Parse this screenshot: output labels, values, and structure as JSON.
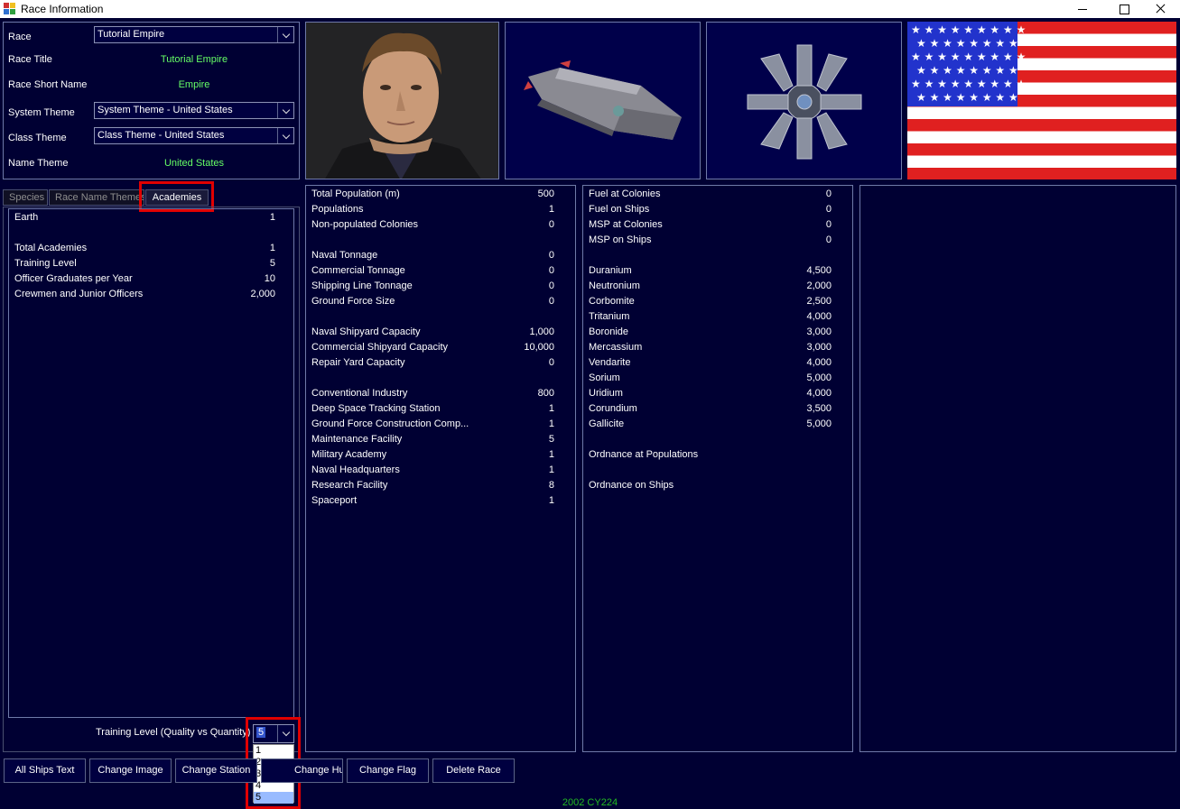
{
  "window": {
    "title": "Race Information"
  },
  "race_info": {
    "race_label": "Race",
    "race_value": "Tutorial Empire",
    "race_title_label": "Race Title",
    "race_title_value": "Tutorial Empire",
    "short_name_label": "Race Short Name",
    "short_name_value": "Empire",
    "system_theme_label": "System Theme",
    "system_theme_value": "System Theme - United States",
    "class_theme_label": "Class Theme",
    "class_theme_value": "Class Theme - United States",
    "name_theme_label": "Name Theme",
    "name_theme_value": "United States"
  },
  "tabs": [
    "Species",
    "Race Name Themes",
    "Academies"
  ],
  "academies": {
    "rows": [
      {
        "k": "Earth",
        "v": "1"
      },
      {
        "k": "",
        "v": ""
      },
      {
        "k": "Total Academies",
        "v": "1"
      },
      {
        "k": "Training Level",
        "v": "5"
      },
      {
        "k": "Officer Graduates per Year",
        "v": "10"
      },
      {
        "k": "Crewmen and Junior Officers",
        "v": "2,000"
      }
    ],
    "training_label": "Training Level (Quality vs Quantity)",
    "training_value": "5",
    "options": [
      "1",
      "2",
      "3",
      "4",
      "5"
    ],
    "selected_option": "5"
  },
  "stats": [
    {
      "k": "Total Population (m)",
      "v": "500"
    },
    {
      "k": "Populations",
      "v": "1"
    },
    {
      "k": "Non-populated Colonies",
      "v": "0"
    },
    {
      "k": "",
      "v": ""
    },
    {
      "k": "Naval Tonnage",
      "v": "0"
    },
    {
      "k": "Commercial Tonnage",
      "v": "0"
    },
    {
      "k": "Shipping Line Tonnage",
      "v": "0"
    },
    {
      "k": "Ground Force Size",
      "v": "0"
    },
    {
      "k": "",
      "v": ""
    },
    {
      "k": "Naval Shipyard Capacity",
      "v": "1,000"
    },
    {
      "k": "Commercial Shipyard Capacity",
      "v": "10,000"
    },
    {
      "k": "Repair Yard Capacity",
      "v": "0"
    },
    {
      "k": "",
      "v": ""
    },
    {
      "k": "Conventional Industry",
      "v": "800"
    },
    {
      "k": "Deep Space Tracking Station",
      "v": "1"
    },
    {
      "k": "Ground Force Construction Comp...",
      "v": "1"
    },
    {
      "k": "Maintenance Facility",
      "v": "5"
    },
    {
      "k": "Military Academy",
      "v": "1"
    },
    {
      "k": "Naval Headquarters",
      "v": "1"
    },
    {
      "k": "Research Facility",
      "v": "8"
    },
    {
      "k": "Spaceport",
      "v": "1"
    }
  ],
  "resources": [
    {
      "k": "Fuel at Colonies",
      "v": "0"
    },
    {
      "k": "Fuel on Ships",
      "v": "0"
    },
    {
      "k": "MSP at Colonies",
      "v": "0"
    },
    {
      "k": "MSP on Ships",
      "v": "0"
    },
    {
      "k": "",
      "v": ""
    },
    {
      "k": "Duranium",
      "v": "4,500"
    },
    {
      "k": "Neutronium",
      "v": "2,000"
    },
    {
      "k": "Corbomite",
      "v": "2,500"
    },
    {
      "k": "Tritanium",
      "v": "4,000"
    },
    {
      "k": "Boronide",
      "v": "3,000"
    },
    {
      "k": "Mercassium",
      "v": "3,000"
    },
    {
      "k": "Vendarite",
      "v": "4,000"
    },
    {
      "k": "Sorium",
      "v": "5,000"
    },
    {
      "k": "Uridium",
      "v": "4,000"
    },
    {
      "k": "Corundium",
      "v": "3,500"
    },
    {
      "k": "Gallicite",
      "v": "5,000"
    },
    {
      "k": "",
      "v": ""
    },
    {
      "k": "Ordnance at Populations",
      "v": ""
    },
    {
      "k": "",
      "v": ""
    },
    {
      "k": "Ordnance on Ships",
      "v": ""
    }
  ],
  "buttons": {
    "all_ships_text": "All Ships Text",
    "change_image": "Change Image",
    "change_station": "Change Station",
    "change_hull": "Change Hull",
    "change_flag": "Change Flag",
    "delete_race": "Delete Race"
  },
  "status": "2002 CY224",
  "colors": {
    "background": "#000033",
    "highlight_label": "#66ff66",
    "status_text": "#22bb22",
    "annotation": "#e00000"
  },
  "icons": [
    "app-icon",
    "minimize-icon",
    "maximize-icon",
    "close-icon",
    "chevron-down-icon"
  ]
}
